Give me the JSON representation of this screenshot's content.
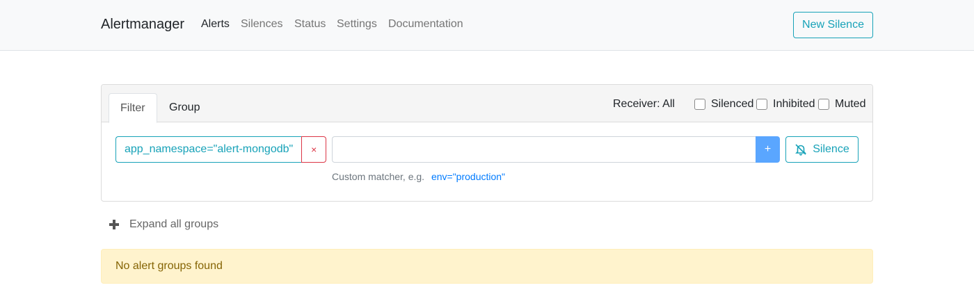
{
  "navbar": {
    "brand": "Alertmanager",
    "links": [
      {
        "label": "Alerts",
        "active": true
      },
      {
        "label": "Silences",
        "active": false
      },
      {
        "label": "Status",
        "active": false
      },
      {
        "label": "Settings",
        "active": false
      },
      {
        "label": "Documentation",
        "active": false
      }
    ],
    "new_silence_label": "New Silence"
  },
  "filter_card": {
    "tabs": [
      {
        "label": "Filter",
        "active": true
      },
      {
        "label": "Group",
        "active": false
      }
    ],
    "receiver_label": "Receiver: All",
    "checkboxes": [
      {
        "label": "Silenced",
        "checked": false
      },
      {
        "label": "Inhibited",
        "checked": false
      },
      {
        "label": "Muted",
        "checked": false
      }
    ],
    "matchers": [
      {
        "text": "app_namespace=\"alert-mongodb\"",
        "remove_label": "×"
      }
    ],
    "matcher_input": {
      "value": "",
      "placeholder": ""
    },
    "add_label": "+",
    "silence_button_label": "Silence",
    "silence_icon": "bell-slash-icon",
    "hint_text": "Custom matcher, e.g.",
    "hint_example": "env=\"production\""
  },
  "expand_all": {
    "icon": "plus-icon",
    "label": "Expand all groups"
  },
  "empty_state": {
    "message": "No alert groups found"
  },
  "colors": {
    "accent": "#17a2b8",
    "danger": "#dc3545",
    "link": "#007bff",
    "add_button": "#5aa6ff",
    "warning_bg": "#fff3cd",
    "warning_text": "#856404"
  }
}
